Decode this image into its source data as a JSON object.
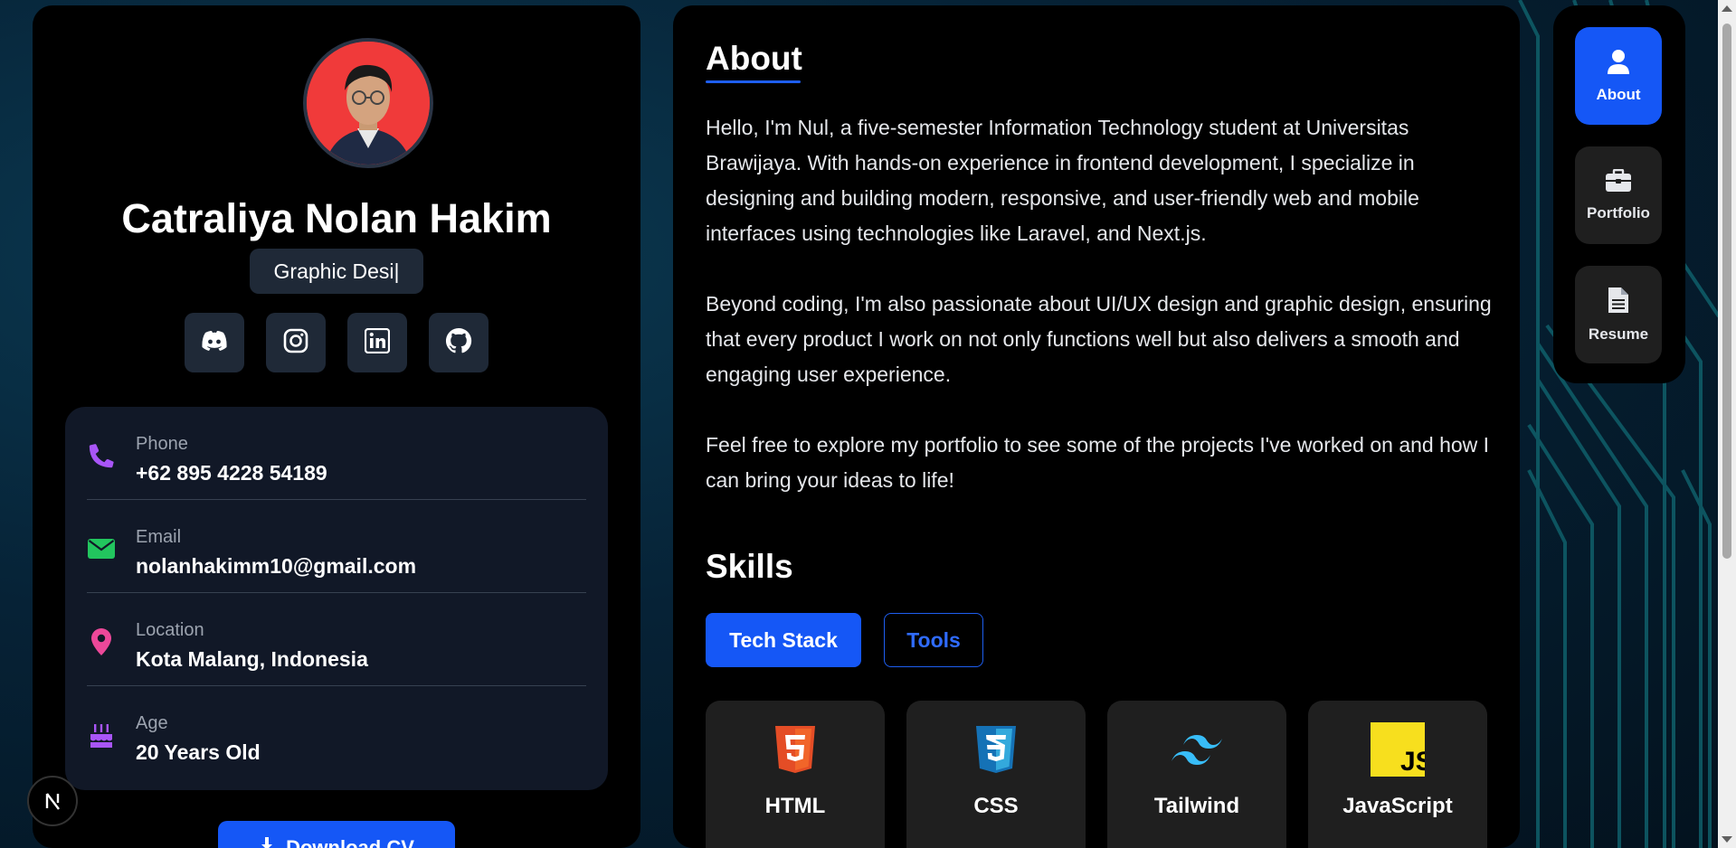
{
  "profile": {
    "name": "Catraliya Nolan Hakim",
    "role_typed": "Graphic Desi|",
    "avatar_alt": "profile photo"
  },
  "socials": [
    {
      "icon": "discord-icon"
    },
    {
      "icon": "instagram-icon"
    },
    {
      "icon": "linkedin-icon"
    },
    {
      "icon": "github-icon"
    }
  ],
  "contact": [
    {
      "icon": "phone-icon",
      "label": "Phone",
      "value": "+62 895 4228 54189",
      "color": "#a855f7"
    },
    {
      "icon": "envelope-icon",
      "label": "Email",
      "value": "nolanhakimm10@gmail.com",
      "color": "#22c55e"
    },
    {
      "icon": "map-pin-icon",
      "label": "Location",
      "value": "Kota Malang, Indonesia",
      "color": "#ec4899"
    },
    {
      "icon": "cake-icon",
      "label": "Age",
      "value": "20 Years Old",
      "color": "#a855f7"
    }
  ],
  "download_button": {
    "label": "Download CV"
  },
  "about": {
    "title": "About",
    "paragraphs": [
      "Hello, I'm Nul, a five-semester Information Technology student at Universitas Brawijaya. With hands-on experience in frontend development, I specialize in designing and building modern, responsive, and user-friendly web and mobile interfaces using technologies like Laravel, and Next.js.",
      "Beyond coding, I'm also passionate about UI/UX design and graphic design, ensuring that every product I work on not only functions well but also delivers a smooth and engaging user experience.",
      "Feel free to explore my portfolio to see some of the projects I've worked on and how I can bring your ideas to life!"
    ]
  },
  "skills": {
    "title": "Skills",
    "tabs": [
      {
        "label": "Tech Stack",
        "active": true
      },
      {
        "label": "Tools",
        "active": false
      }
    ],
    "items": [
      {
        "label": "HTML",
        "icon": "html5-icon",
        "color": "#f16524"
      },
      {
        "label": "CSS",
        "icon": "css3-icon",
        "color": "#2965f1"
      },
      {
        "label": "Tailwind",
        "icon": "tailwind-icon",
        "color": "#38bdf8"
      },
      {
        "label": "JavaScript",
        "icon": "javascript-icon",
        "color": "#f7df1e"
      }
    ]
  },
  "nav": [
    {
      "label": "About",
      "icon": "user-icon",
      "active": true
    },
    {
      "label": "Portfolio",
      "icon": "briefcase-icon",
      "active": false
    },
    {
      "label": "Resume",
      "icon": "document-icon",
      "active": false
    }
  ],
  "colors": {
    "accent": "#1557f6",
    "card": "#000000",
    "subcard": "#111827"
  }
}
